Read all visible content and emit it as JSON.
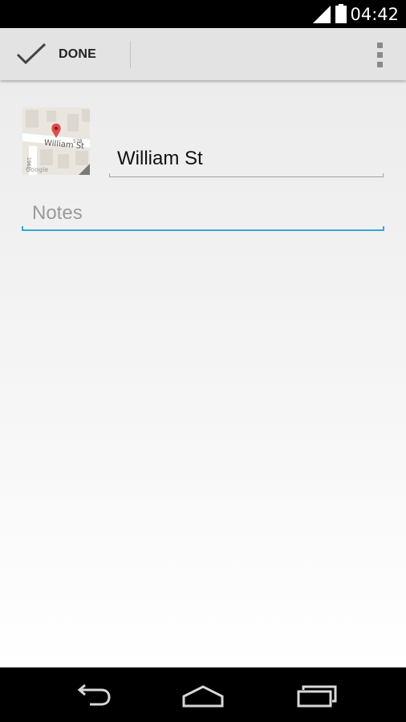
{
  "status_bar": {
    "time": "04:42",
    "icons": [
      "signal-icon",
      "battery-icon"
    ]
  },
  "action_bar": {
    "done_label": "DONE",
    "done_icon": "check-icon",
    "overflow_icon": "overflow-menu-icon"
  },
  "editor": {
    "title_value": "William St",
    "notes_placeholder": "Notes",
    "accent_color": "#33a6d9"
  },
  "map_thumbnail": {
    "street_label": "William St",
    "number_label_top": "578",
    "number_label_side": "1960",
    "attribution": "Google",
    "pin_color": "#e04b4b"
  },
  "nav_bar": {
    "icons": [
      "back-icon",
      "home-icon",
      "recent-apps-icon"
    ]
  }
}
